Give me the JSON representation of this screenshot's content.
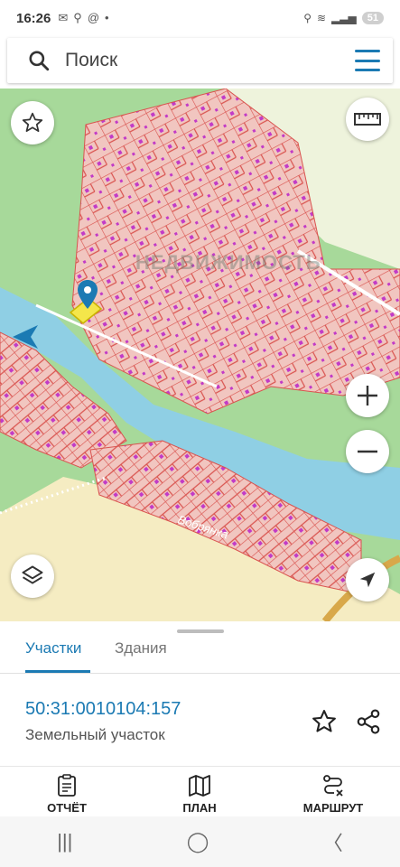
{
  "status_bar": {
    "time": "16:26",
    "battery": "51"
  },
  "search": {
    "placeholder": "Поиск"
  },
  "map": {
    "watermark": "НЕДВИЖИМОСТЬ",
    "river_label": "Вобрянка"
  },
  "tabs": [
    {
      "label": "Участки",
      "active": true
    },
    {
      "label": "Здания",
      "active": false
    }
  ],
  "parcel": {
    "cadastral_number": "50:31:0010104:157",
    "type": "Земельный участок"
  },
  "bottom_nav": [
    {
      "label": "ОТЧЁТ",
      "icon": "report-icon"
    },
    {
      "label": "ПЛАН",
      "icon": "map-plan-icon"
    },
    {
      "label": "МАРШРУТ",
      "icon": "route-icon"
    }
  ],
  "colors": {
    "accent": "#1b7ab3",
    "parcel_fill": "#f1c6c0",
    "parcel_stroke": "#d9534f",
    "water": "#8fcfe4",
    "forest": "#a7d99a",
    "field": "#f5ecc2"
  }
}
